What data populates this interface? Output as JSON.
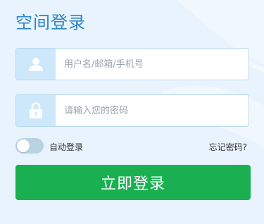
{
  "page": {
    "title": "空间登录"
  },
  "form": {
    "username_placeholder": "用户名/邮箱/手机号",
    "username_value": "",
    "password_placeholder": "请输入您的密码",
    "password_value": "",
    "auto_login_label": "自动登录",
    "auto_login_checked": false,
    "forgot_password_label": "忘记密码?",
    "submit_label": "立即登录"
  },
  "icons": {
    "username": "user-icon",
    "password": "lock-icon"
  },
  "colors": {
    "title": "#2e86c6",
    "button": "#1ab052",
    "icon_box": "#cde7fb",
    "background": "#e8f3fd"
  }
}
